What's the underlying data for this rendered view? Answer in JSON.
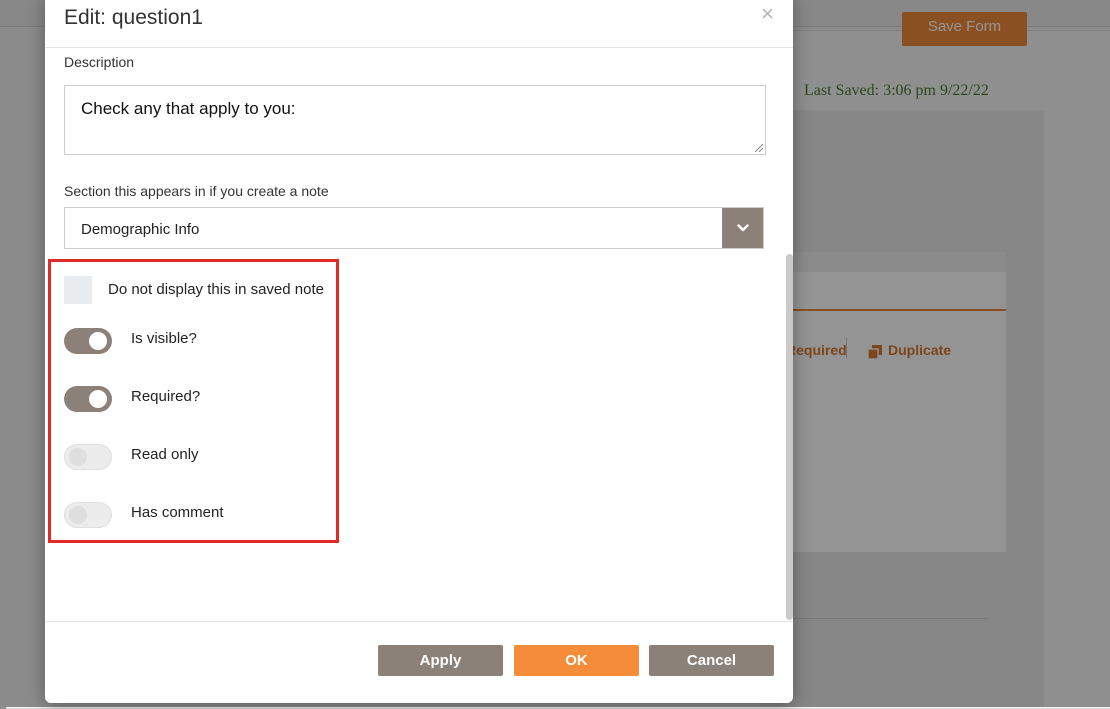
{
  "background": {
    "save_form_label": "Save Form",
    "last_saved": "Last Saved: 3:06 pm 9/22/22",
    "required_link": "Required",
    "duplicate_link": "Duplicate"
  },
  "modal": {
    "title": "Edit: question1",
    "close_glyph": "×",
    "description_label": "Description",
    "description_value": "Check any that apply to you:",
    "section_label": "Section this appears in if you create a note",
    "section_value": "Demographic Info",
    "options": {
      "do_not_display": {
        "label": "Do not display this in saved note",
        "checked": false
      },
      "is_visible": {
        "label": "Is visible?",
        "on": true
      },
      "required": {
        "label": "Required?",
        "on": true
      },
      "read_only": {
        "label": "Read only",
        "on": false
      },
      "has_comment": {
        "label": "Has comment",
        "on": false
      }
    },
    "buttons": {
      "apply": "Apply",
      "ok": "OK",
      "cancel": "Cancel"
    }
  },
  "colors": {
    "accent_orange": "#f58c3a",
    "button_taupe": "#8c8178",
    "highlight_red": "#e32a2a",
    "saved_green": "#4a7d2e"
  },
  "icons": [
    "close-icon",
    "chevron-down-icon",
    "duplicate-icon",
    "resize-grip-icon"
  ]
}
